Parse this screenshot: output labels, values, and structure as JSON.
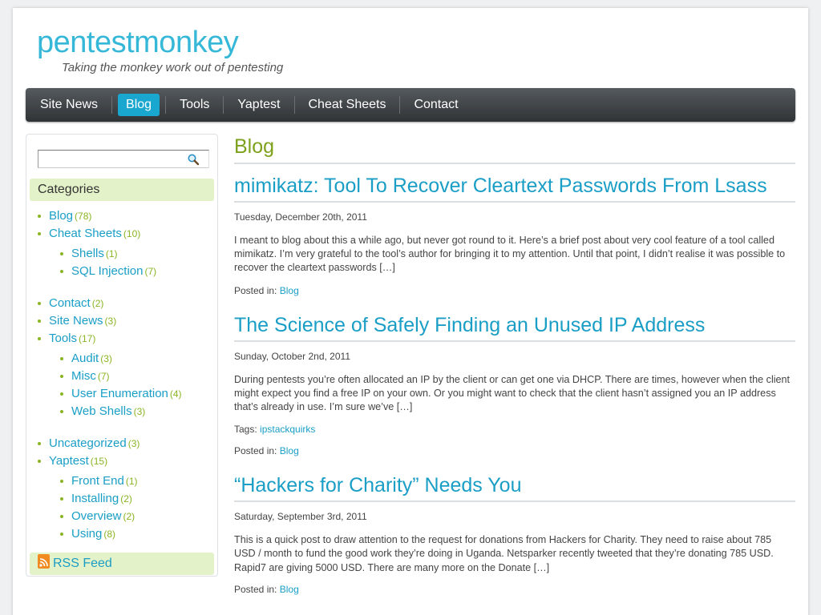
{
  "site": {
    "title": "pentestmonkey",
    "tagline": "Taking the monkey work out of pentesting"
  },
  "nav": {
    "items": [
      {
        "label": "Site News"
      },
      {
        "label": "Blog"
      },
      {
        "label": "Tools"
      },
      {
        "label": "Yaptest"
      },
      {
        "label": "Cheat Sheets"
      },
      {
        "label": "Contact"
      }
    ],
    "active": "Blog"
  },
  "sidebar": {
    "search": {
      "value": "",
      "placeholder": ""
    },
    "categories_title": "Categories",
    "categories": [
      {
        "label": "Blog",
        "count": "(78)"
      },
      {
        "label": "Cheat Sheets",
        "count": "(10)",
        "children": [
          {
            "label": "Shells",
            "count": "(1)"
          },
          {
            "label": "SQL Injection",
            "count": "(7)"
          }
        ]
      },
      {
        "label": "Contact",
        "count": "(2)"
      },
      {
        "label": "Site News",
        "count": "(3)"
      },
      {
        "label": "Tools",
        "count": "(17)",
        "children": [
          {
            "label": "Audit",
            "count": "(3)"
          },
          {
            "label": "Misc",
            "count": "(7)"
          },
          {
            "label": "User Enumeration",
            "count": "(4)"
          },
          {
            "label": "Web Shells",
            "count": "(3)"
          }
        ]
      },
      {
        "label": "Uncategorized",
        "count": "(3)"
      },
      {
        "label": "Yaptest",
        "count": "(15)",
        "children": [
          {
            "label": "Front End",
            "count": "(1)"
          },
          {
            "label": "Installing",
            "count": "(2)"
          },
          {
            "label": "Overview",
            "count": "(2)"
          },
          {
            "label": "Using",
            "count": "(8)"
          }
        ]
      }
    ],
    "rss_label": "RSS Feed"
  },
  "main": {
    "heading": "Blog",
    "posts": [
      {
        "title": "mimikatz: Tool To Recover Cleartext Passwords From Lsass",
        "date": "Tuesday, December 20th, 2011",
        "excerpt": "I meant to blog about this a while ago, but never got round to it. Here’s a brief post about very cool feature of a tool called mimikatz. I’m very grateful to the tool’s author for bringing it to my attention. Until that point, I didn’t realise it was possible to recover the cleartext passwords […]",
        "tags_label": "",
        "tags": "",
        "posted_in_label": "Posted in:",
        "category": "Blog"
      },
      {
        "title": "The Science of Safely Finding an Unused IP Address",
        "date": "Sunday, October 2nd, 2011",
        "excerpt": "During pentests you’re often allocated an IP by the client or can get one via DHCP. There are times, however when the client might expect you find a free IP on your own. Or you might want to check that the client hasn’t assigned you an IP address that’s already in use. I’m sure we’ve […]",
        "tags_label": "Tags:",
        "tags": "ipstackquirks",
        "posted_in_label": "Posted in:",
        "category": "Blog"
      },
      {
        "title": "“Hackers for Charity” Needs You",
        "date": "Saturday, September 3rd, 2011",
        "excerpt": "This is a quick post to draw attention to the request for donations from Hackers for Charity. They need to raise about 785 USD / month to fund the good work they’re doing in Uganda. Netsparker recently tweeted that they’re donating 785 USD.  Rapid7 are giving 5000 USD.  There are many more on the Donate […]",
        "tags_label": "",
        "tags": "",
        "posted_in_label": "Posted in:",
        "category": "Blog"
      }
    ]
  },
  "colors": {
    "accent": "#1a9ec6",
    "title": "#35b7d8",
    "heading_green": "#7ea11c",
    "count_green": "#8ab524",
    "widget_bg": "#e4f2c9",
    "nav_active": "#1aa7cf"
  },
  "icons": {
    "search": "magnifier-icon",
    "rss": "rss-icon"
  }
}
